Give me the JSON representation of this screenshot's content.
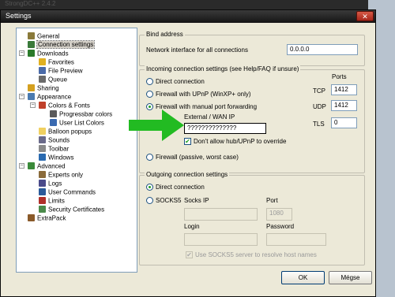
{
  "background": {
    "app_title": "StrongDC++ 2.4.2"
  },
  "window": {
    "title": "Settings",
    "close_glyph": "✕"
  },
  "tree": [
    {
      "label": "General",
      "icon": "general-icon",
      "color": "#8a7a3a"
    },
    {
      "label": "Connection settings",
      "icon": "connection-icon",
      "color": "#3a7a3a",
      "selected": true
    },
    {
      "label": "Downloads",
      "icon": "downloads-icon",
      "color": "#2a7a2a"
    },
    {
      "label": "Favorites",
      "icon": "favorites-icon",
      "color": "#e0b020"
    },
    {
      "label": "File Preview",
      "icon": "preview-icon",
      "color": "#4a6aa8"
    },
    {
      "label": "Queue",
      "icon": "queue-icon",
      "color": "#6a6a6a"
    },
    {
      "label": "Sharing",
      "icon": "sharing-icon",
      "color": "#d4a020"
    },
    {
      "label": "Appearance",
      "icon": "appearance-icon",
      "color": "#4a7ab0"
    },
    {
      "label": "Colors & Fonts",
      "icon": "colors-icon",
      "color": "#c0402a"
    },
    {
      "label": "Progressbar colors",
      "icon": "progressbar-icon",
      "color": "#5a5a5a"
    },
    {
      "label": "User List Colors",
      "icon": "userlist-icon",
      "color": "#3a6ab0"
    },
    {
      "label": "Balloon popups",
      "icon": "balloon-icon",
      "color": "#f0d060"
    },
    {
      "label": "Sounds",
      "icon": "sounds-icon",
      "color": "#6a6a8a"
    },
    {
      "label": "Toolbar",
      "icon": "toolbar-icon",
      "color": "#8a8a8a"
    },
    {
      "label": "Windows",
      "icon": "windows-icon",
      "color": "#2a6ab0"
    },
    {
      "label": "Advanced",
      "icon": "advanced-icon",
      "color": "#3a8a3a"
    },
    {
      "label": "Experts only",
      "icon": "experts-icon",
      "color": "#8a6a3a"
    },
    {
      "label": "Logs",
      "icon": "logs-icon",
      "color": "#4a4a8a"
    },
    {
      "label": "User Commands",
      "icon": "usercmd-icon",
      "color": "#2a5a9a"
    },
    {
      "label": "Limits",
      "icon": "limits-icon",
      "color": "#b0302a"
    },
    {
      "label": "Security Certificates",
      "icon": "certificates-icon",
      "color": "#4a8a4a"
    },
    {
      "label": "ExtraPack",
      "icon": "extrapack-icon",
      "color": "#8a5a2a"
    }
  ],
  "bind": {
    "legend": "Bind address",
    "network_label": "Network interface for all connections",
    "network_value": "0.0.0.0"
  },
  "incoming": {
    "legend": "Incoming connection settings (see Help/FAQ if unsure)",
    "ports_label": "Ports",
    "direct": "Direct connection",
    "upnp": "Firewall with UPnP (WinXP+ only)",
    "manual": "Firewall with manual port forwarding",
    "passive": "Firewall (passive, worst case)",
    "tcp_label": "TCP",
    "tcp_value": "1412",
    "udp_label": "UDP",
    "udp_value": "1412",
    "tls_label": "TLS",
    "tls_value": "0",
    "wan_label": "External / WAN IP",
    "wan_value": "??????????????",
    "override_label": "Don't allow hub/UPnP to override"
  },
  "outgoing": {
    "legend": "Outgoing connection settings",
    "direct": "Direct connection",
    "socks5": "SOCKS5",
    "socks_ip_label": "Socks IP",
    "port_label": "Port",
    "port_value": "1080",
    "login_label": "Login",
    "password_label": "Password",
    "resolve_label": "Use SOCKS5 server to resolve host names"
  },
  "buttons": {
    "ok": "OK",
    "cancel": "Mégse"
  },
  "colors": {
    "arrow": "#22bb22"
  }
}
